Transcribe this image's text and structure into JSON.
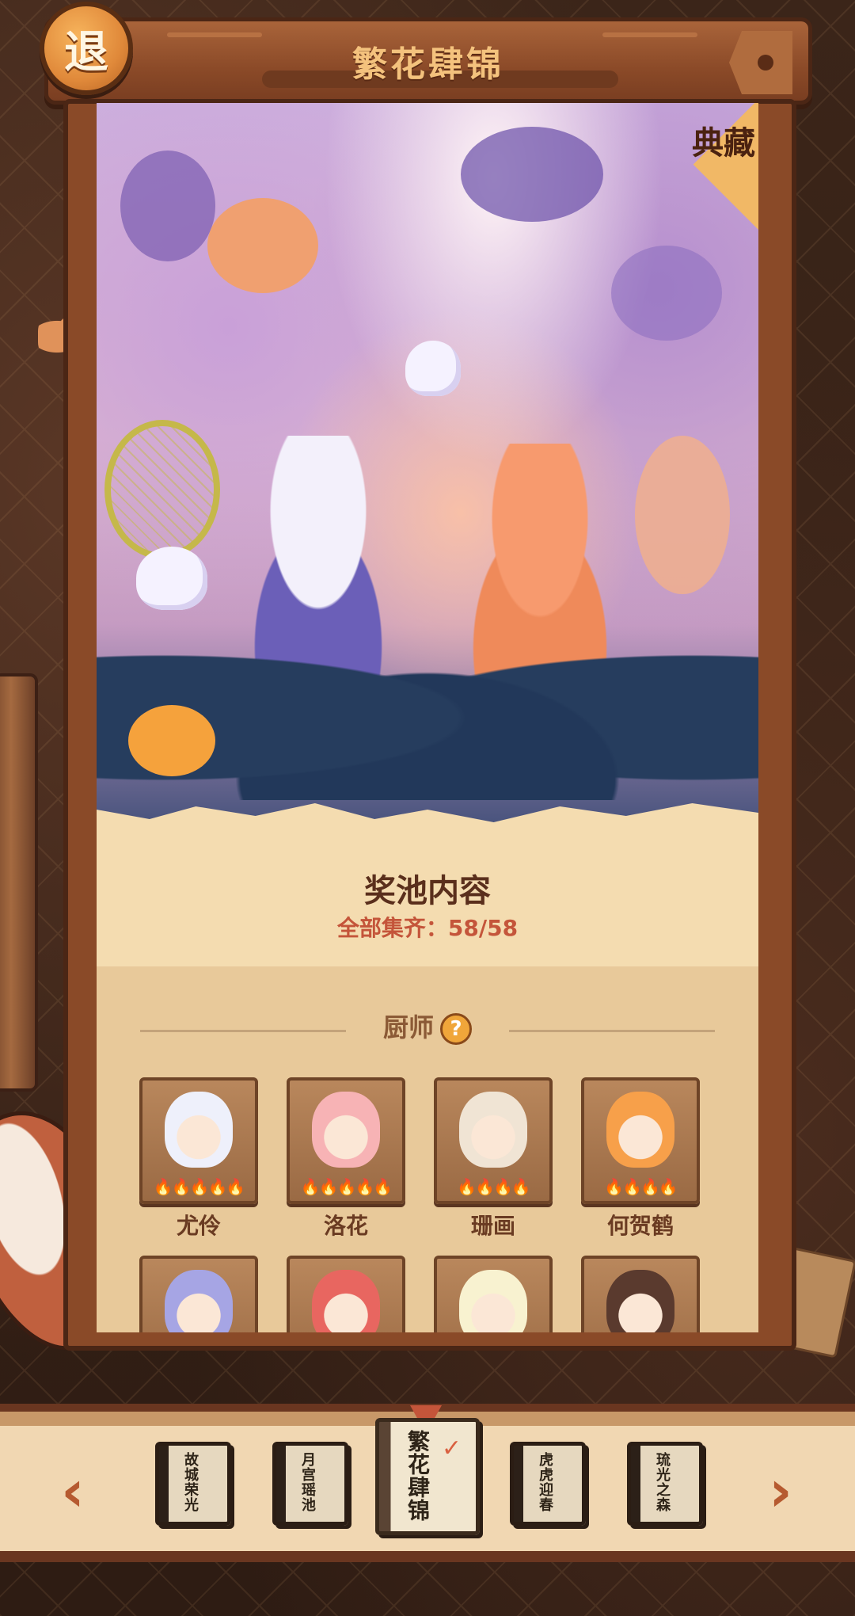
{
  "header": {
    "back_label": "退",
    "title": "繁花肆锦"
  },
  "banner": {
    "ribbon_label": "典藏"
  },
  "pool": {
    "title": "奖池内容",
    "completion": "全部集齐：58/58"
  },
  "chef_section": {
    "title": "厨师",
    "help_icon": "question-icon",
    "chefs": [
      {
        "name": "尤伶",
        "stars": 5,
        "color": "#eef0fb"
      },
      {
        "name": "洛花",
        "stars": 5,
        "color": "#f7b3b5"
      },
      {
        "name": "珊画",
        "stars": 4,
        "color": "#f0e4d4"
      },
      {
        "name": "何贺鹤",
        "stars": 4,
        "color": "#f7a04a"
      },
      {
        "name": "",
        "stars": 0,
        "color": "#a6a5e4"
      },
      {
        "name": "",
        "stars": 0,
        "color": "#e86660"
      },
      {
        "name": "",
        "stars": 0,
        "color": "#f8f2d0"
      },
      {
        "name": "",
        "stars": 0,
        "color": "#5a3a2e"
      }
    ]
  },
  "bottom_nav": {
    "prev_icon": "chevron-left-icon",
    "next_icon": "chevron-right-icon",
    "books": [
      {
        "title": "故城荣光",
        "active": false
      },
      {
        "title": "月宫瑶池",
        "active": false
      },
      {
        "title": "繁花肆锦",
        "active": true
      },
      {
        "title": "虎虎迎春",
        "active": false
      },
      {
        "title": "琉光之森",
        "active": false
      }
    ]
  },
  "colors": {
    "title_text": "#f4c27d",
    "accent_red": "#c4553a",
    "frame_brown": "#8a4a28"
  }
}
